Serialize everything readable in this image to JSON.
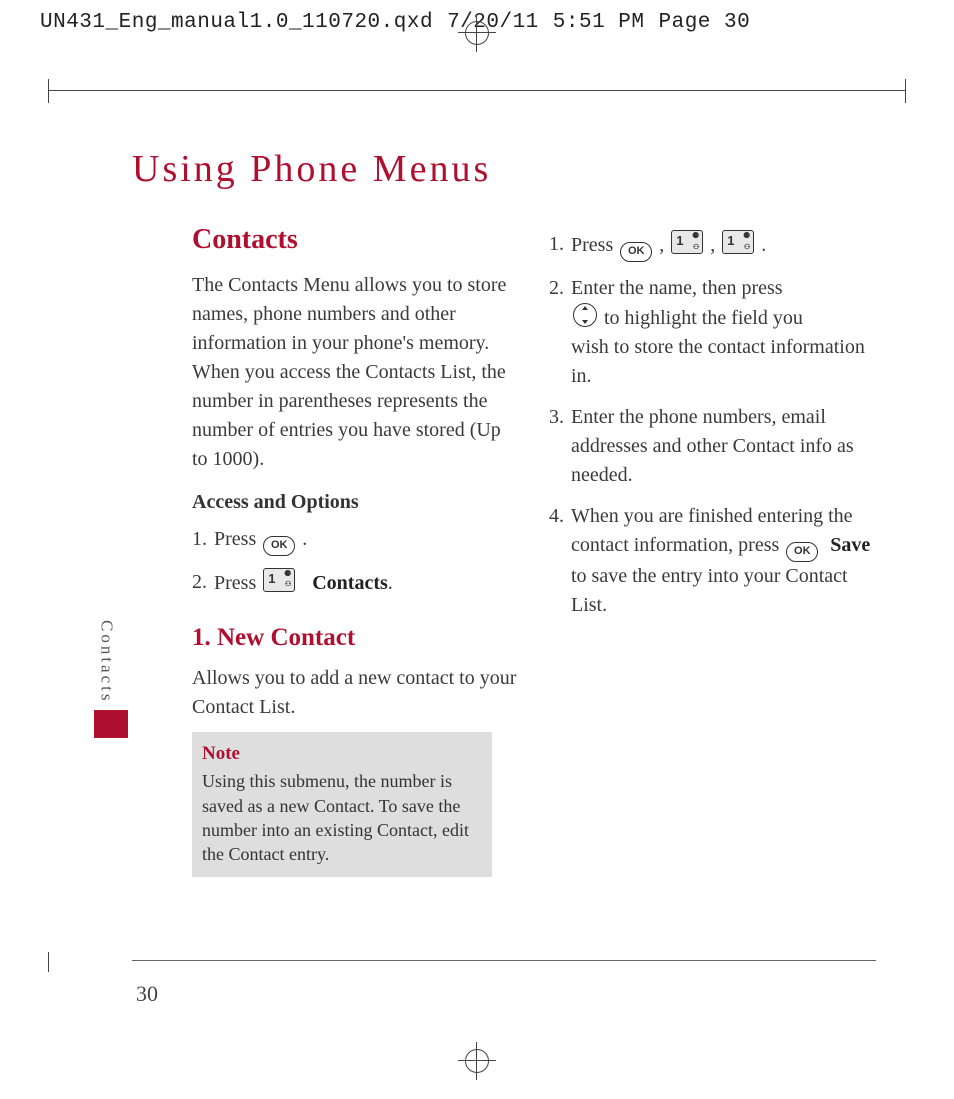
{
  "header": {
    "file": "UN431_Eng_manual1.0_110720.qxd",
    "date": "7/20/11",
    "time": "5:51 PM",
    "pagelabel": "Page 30"
  },
  "title": "Using Phone Menus",
  "sideTab": "Contacts",
  "pageNumber": "30",
  "left": {
    "h_contacts": "Contacts",
    "intro": "The Contacts Menu allows you to store names, phone numbers and other information in your phone's memory. When you access the Contacts List, the number in parentheses represents the number of entries you have stored (Up to 1000).",
    "h_access": "Access and Options",
    "step1_pre": "Press ",
    "step1_post": " .",
    "step2_pre": "Press ",
    "step2_bold": "Contacts",
    "step2_post": ".",
    "h_newcontact": "1. New Contact",
    "newcontact_text": "Allows you to add a new contact to your Contact List.",
    "note_title": "Note",
    "note_text": "Using this submenu, the number is saved as a new Contact. To save the number into an existing Contact, edit the Contact entry."
  },
  "right": {
    "s1_pre": "Press ",
    "s1_sep": " ,  ",
    "s1_end": " .",
    "s2_line1_pre": "Enter the name, then press",
    "s2_line2_pre": " to highlight the field you",
    "s2_rest": "wish to store the contact information in.",
    "s3": "Enter the phone numbers, email addresses and other Contact info as needed.",
    "s4_pre": "When you are finished entering the contact information, press ",
    "s4_bold": "Save",
    "s4_post": " to save the entry into your Contact List."
  },
  "keys": {
    "ok": "OK"
  }
}
